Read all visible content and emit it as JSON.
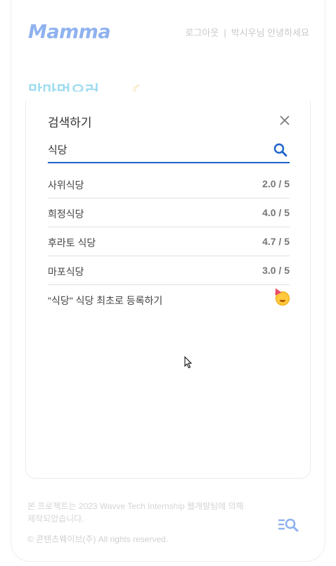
{
  "header": {
    "logo": "Mamma",
    "logout": "로그아웃",
    "separator": "|",
    "user_name": "박시우",
    "greeting": "님 안녕하세요"
  },
  "hero": {
    "partial_text": "맘마먹으러",
    "moon": "☾"
  },
  "search_modal": {
    "title": "검색하기",
    "query": "식당",
    "results": [
      {
        "name": "사위식당",
        "score": "2.0 / 5"
      },
      {
        "name": "희정식당",
        "score": "4.0 / 5"
      },
      {
        "name": "후라토 식당",
        "score": "4.7 / 5"
      },
      {
        "name": "마포식당",
        "score": "3.0 / 5"
      }
    ],
    "register": {
      "label": "\"식당\" 식당 최초로 등록하기",
      "icon": "partying-face-icon"
    }
  },
  "footer": {
    "line1": "본 프로젝트는 2023 Wavve Tech Internship 웹개발팀에 의해",
    "line2": "제작되었습니다.",
    "copyright": "© 콘텐츠웨이브(주) All rights reserved."
  },
  "colors": {
    "accent": "#1e63c9",
    "logo": "#8fb2ef"
  }
}
